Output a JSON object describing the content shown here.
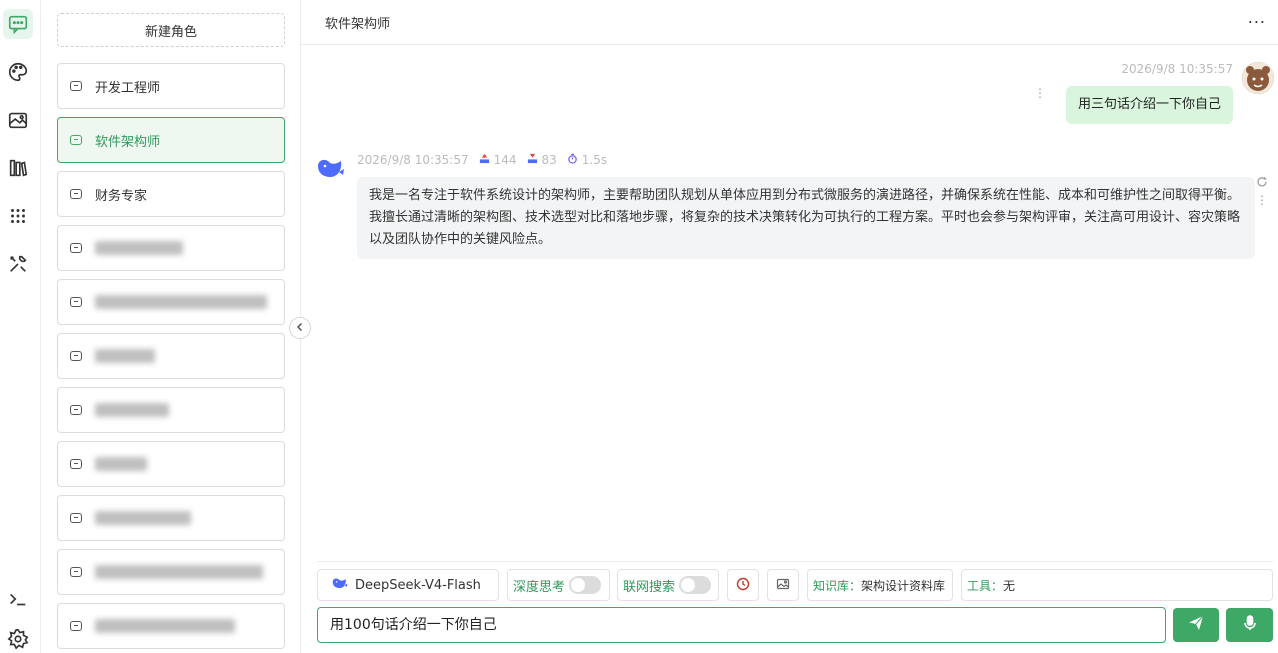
{
  "rail": {
    "icons": [
      "chat-icon",
      "palette-icon",
      "image-gallery-icon",
      "library-icon",
      "apps-grid-icon",
      "tools-icon",
      "terminal-icon",
      "settings-icon"
    ],
    "accent": "#3ea867"
  },
  "roles": {
    "new_role_label": "新建角色",
    "items": [
      {
        "label": "开发工程师",
        "blurred": false
      },
      {
        "label": "软件架构师",
        "blurred": false,
        "active": true
      },
      {
        "label": "财务专家",
        "blurred": false
      },
      {
        "label": "",
        "blurred": true
      },
      {
        "label": "",
        "blurred": true
      },
      {
        "label": "",
        "blurred": true
      },
      {
        "label": "",
        "blurred": true
      },
      {
        "label": "",
        "blurred": true
      },
      {
        "label": "",
        "blurred": true
      },
      {
        "label": "",
        "blurred": true
      },
      {
        "label": "",
        "blurred": true
      }
    ]
  },
  "header": {
    "title": "软件架构师",
    "more": "..."
  },
  "messages": {
    "user": {
      "time": "2026/9/8 10:35:57",
      "text": "用三句话介绍一下你自己"
    },
    "ai": {
      "time": "2026/9/8 10:35:57",
      "tokens_in": "144",
      "tokens_out": "83",
      "duration": "1.5s",
      "text": "我是一名专注于软件系统设计的架构师，主要帮助团队规划从单体应用到分布式微服务的演进路径，并确保系统在性能、成本和可维护性之间取得平衡。我擅长通过清晰的架构图、技术选型对比和落地步骤，将复杂的技术决策转化为可执行的工程方案。平时也会参与架构评审，关注高可用设计、容灾策略以及团队协作中的关键风险点。"
    }
  },
  "toolbar": {
    "model": "DeepSeek-V4-Flash",
    "deep_think": "深度思考",
    "web_search": "联网搜索",
    "kb_label": "知识库：",
    "kb_value": "架构设计资料库",
    "tools_label": "工具：",
    "tools_value": "无"
  },
  "input": {
    "value": "用100句话介绍一下你自己"
  }
}
